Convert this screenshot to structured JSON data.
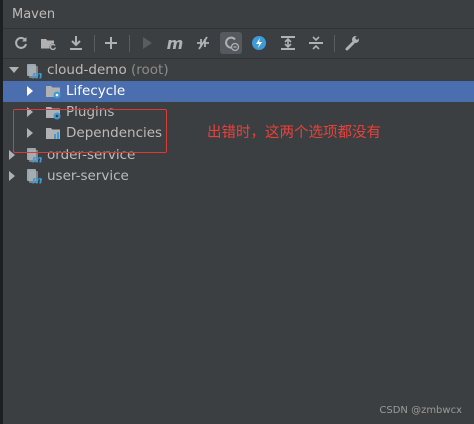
{
  "window": {
    "title": "Maven"
  },
  "toolbar": {
    "buttons": [
      {
        "name": "reload-icon",
        "tooltip": "Reload All Maven Projects"
      },
      {
        "name": "generate-sources-icon",
        "tooltip": "Generate Sources and Update Folders"
      },
      {
        "name": "download-icon",
        "tooltip": "Download Sources and/or Documentation"
      },
      {
        "name": "add-icon",
        "tooltip": "Add Maven Projects"
      },
      {
        "name": "run-icon",
        "tooltip": "Run Maven Build"
      },
      {
        "name": "execute-goal-icon",
        "tooltip": "Execute Maven Goal"
      },
      {
        "name": "toggle-offline-icon",
        "tooltip": "Toggle Offline Mode"
      },
      {
        "name": "skip-tests-icon",
        "tooltip": "Toggle 'Skip Tests' Mode"
      },
      {
        "name": "show-dependencies-icon",
        "tooltip": "Show Dependencies"
      },
      {
        "name": "expand-all-icon",
        "tooltip": "Expand All"
      },
      {
        "name": "collapse-all-icon",
        "tooltip": "Collapse All"
      },
      {
        "name": "settings-wrench-icon",
        "tooltip": "Maven Settings"
      }
    ],
    "m_glyph": "m"
  },
  "tree": {
    "root": {
      "label": "cloud-demo",
      "suffix": " (root)"
    },
    "lifecycle": {
      "label": "Lifecycle"
    },
    "plugins": {
      "label": "Plugins"
    },
    "dependencies": {
      "label": "Dependencies"
    },
    "order_service": {
      "label": "order-service"
    },
    "user_service": {
      "label": "user-service"
    }
  },
  "annotation": {
    "text": "出错时，这两个选项都没有"
  },
  "watermark": {
    "text": "CSDN @zmbwcx"
  },
  "colors": {
    "panel": "#3c3f41",
    "selection": "#4b6eaf",
    "annotation_red": "#e8413b",
    "maven_blue": "#3f9bd6"
  }
}
